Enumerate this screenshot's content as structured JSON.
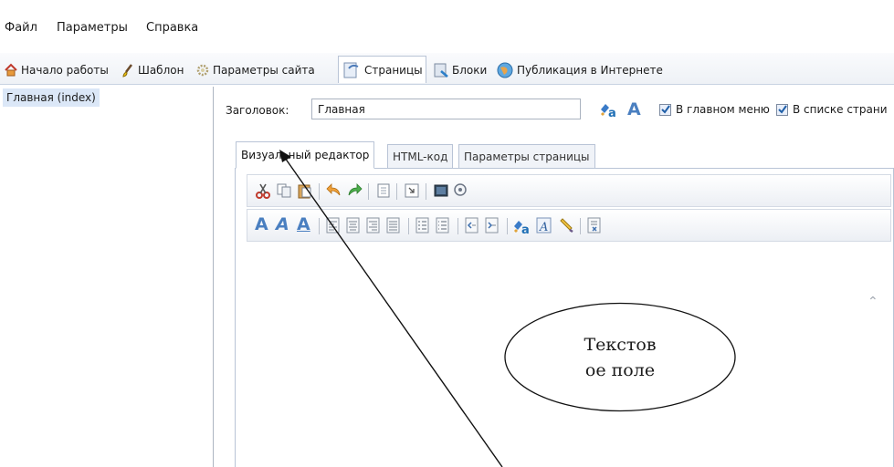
{
  "menubar": {
    "items": [
      "Файл",
      "Параметры",
      "Справка"
    ]
  },
  "tabs": [
    {
      "label": "Начало работы",
      "icon": "home-icon"
    },
    {
      "label": "Шаблон",
      "icon": "brush-icon"
    },
    {
      "label": "Параметры сайта",
      "icon": "gear-icon"
    },
    {
      "label": "Страницы",
      "icon": "pages-icon",
      "active": true
    },
    {
      "label": "Блоки",
      "icon": "blocks-icon"
    },
    {
      "label": "Публикация в Интернете",
      "icon": "globe-icon"
    }
  ],
  "sidebar": {
    "pages": [
      "Главная (index)"
    ]
  },
  "page_title": {
    "label": "Заголовок:",
    "value": "Главная"
  },
  "options": {
    "in_main_menu": {
      "label": "В главном меню",
      "checked": true
    },
    "in_page_list": {
      "label": "В списке страни",
      "checked": true
    }
  },
  "editor_tabs": [
    "Визуальный редактор",
    "HTML-код",
    "Параметры страницы"
  ],
  "toolbar1": [
    "cut-icon",
    "copy-icon",
    "paste-icon",
    "undo-icon",
    "redo-icon",
    "insert-icon",
    "indent-icon",
    "image-icon",
    "zoom-icon"
  ],
  "toolbar2": [
    "bold-a-icon",
    "italic-a-icon",
    "underline-a-icon",
    "align-left-icon",
    "align-center-icon",
    "align-right-icon",
    "justify-icon",
    "numbered-list-icon",
    "bullet-list-icon",
    "outdent-icon",
    "indent-right-icon",
    "text-color-icon",
    "font-icon",
    "highlighter-icon",
    "clear-format-icon"
  ],
  "callout": {
    "line1": "Текстов",
    "line2": "ое поле"
  },
  "colors": {
    "accent": "#dbe7f7",
    "border": "#b9c4d6",
    "text": "#1b1b1b"
  }
}
